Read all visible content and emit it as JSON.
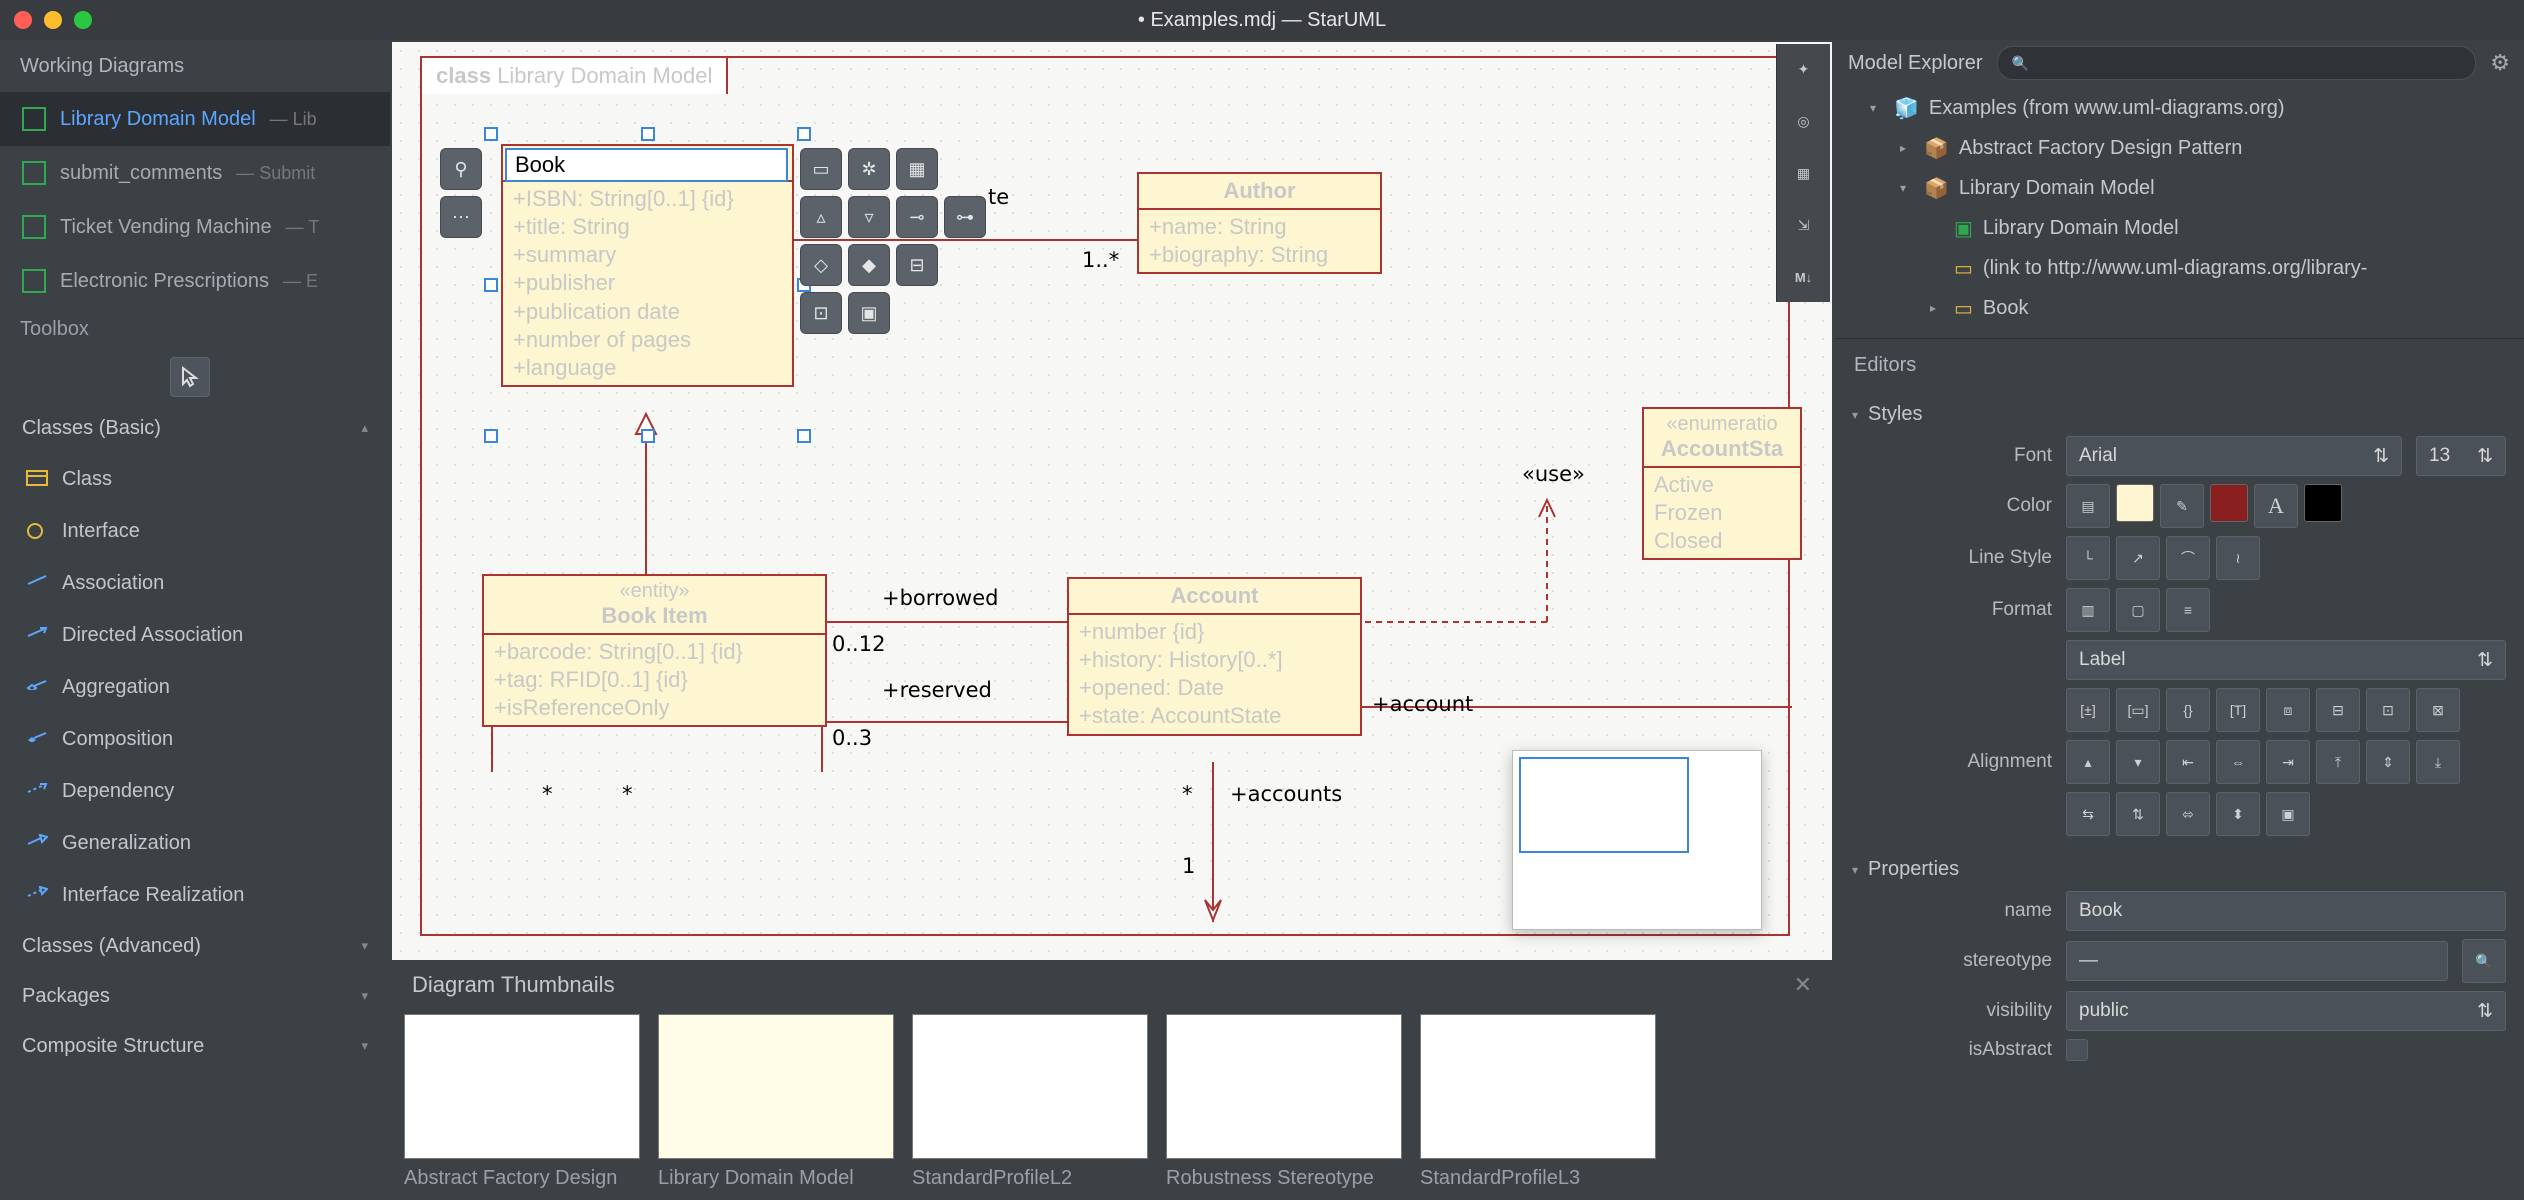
{
  "window": {
    "title": "• Examples.mdj — StarUML"
  },
  "left": {
    "working_diagrams_title": "Working Diagrams",
    "diagrams": [
      {
        "name": "Library Domain Model",
        "meta": "— Lib",
        "active": true
      },
      {
        "name": "submit_comments",
        "meta": "— Submit"
      },
      {
        "name": "Ticket Vending Machine",
        "meta": "— T"
      },
      {
        "name": "Electronic Prescriptions",
        "meta": "— E"
      }
    ],
    "toolbox_title": "Toolbox",
    "sections": {
      "basic": {
        "label": "Classes (Basic)",
        "open": true
      },
      "advanced": {
        "label": "Classes (Advanced)",
        "open": false
      },
      "packages": {
        "label": "Packages",
        "open": false
      },
      "composite": {
        "label": "Composite Structure",
        "open": false
      }
    },
    "tools": [
      "Class",
      "Interface",
      "Association",
      "Directed Association",
      "Aggregation",
      "Composition",
      "Dependency",
      "Generalization",
      "Interface Realization"
    ]
  },
  "canvas": {
    "frame_title_kind": "class",
    "frame_title_name": "Library Domain Model",
    "editing_value": "Book",
    "book": {
      "name": "Book",
      "attrs": [
        "+ISBN: String[0..1] {id}",
        "+title: String",
        "+summary",
        "+publisher",
        "+publication date",
        "+number of pages",
        "+language"
      ]
    },
    "author": {
      "name": "Author",
      "attrs": [
        "+name: String",
        "+biography: String"
      ]
    },
    "author_mult": "1..*",
    "bookitem": {
      "stereo": "«entity»",
      "name": "Book Item",
      "attrs": [
        "+barcode: String[0..1] {id}",
        "+tag: RFID[0..1] {id}",
        "+isReferenceOnly"
      ]
    },
    "account": {
      "name": "Account",
      "attrs": [
        "+number {id}",
        "+history: History[0..*]",
        "+opened: Date",
        "+state: AccountState"
      ]
    },
    "enum": {
      "stereo": "«enumeratio",
      "name": "AccountSta",
      "literals": [
        "Active",
        "Frozen",
        "Closed"
      ]
    },
    "labels": {
      "borrowed": "+borrowed",
      "b012": "0..12",
      "reserved": "+reserved",
      "r03": "0..3",
      "use": "«use»",
      "account": "+account",
      "accounts": "+accounts",
      "star1": "*",
      "star2": "*",
      "star3": "*",
      "one": "1",
      "te": "te"
    }
  },
  "thumbnails": {
    "title": "Diagram Thumbnails",
    "items": [
      "Abstract Factory Design",
      "Library Domain Model",
      "StandardProfileL2",
      "Robustness Stereotype",
      "StandardProfileL3"
    ]
  },
  "right": {
    "explorer_title": "Model Explorer",
    "search_placeholder": "",
    "tree": {
      "root": "Examples (from www.uml-diagrams.org)",
      "n1": "Abstract Factory Design Pattern",
      "n2": "Library Domain Model",
      "n2a": "Library Domain Model",
      "n2b": "(link to http://www.uml-diagrams.org/library-",
      "n2c": "Book"
    },
    "editors_title": "Editors",
    "styles_title": "Styles",
    "font_label": "Font",
    "font_value": "Arial",
    "font_size": "13",
    "color_label": "Color",
    "fill_color": "#fdf6d0",
    "line_color": "#8a1f1f",
    "text_color": "#000000",
    "linestyle_label": "Line Style",
    "format_label": "Format",
    "format_value": "Label",
    "alignment_label": "Alignment",
    "properties_title": "Properties",
    "prop_name_label": "name",
    "prop_name_value": "Book",
    "prop_stereo_label": "stereotype",
    "prop_stereo_value": "—",
    "prop_vis_label": "visibility",
    "prop_vis_value": "public",
    "prop_abs_label": "isAbstract"
  }
}
